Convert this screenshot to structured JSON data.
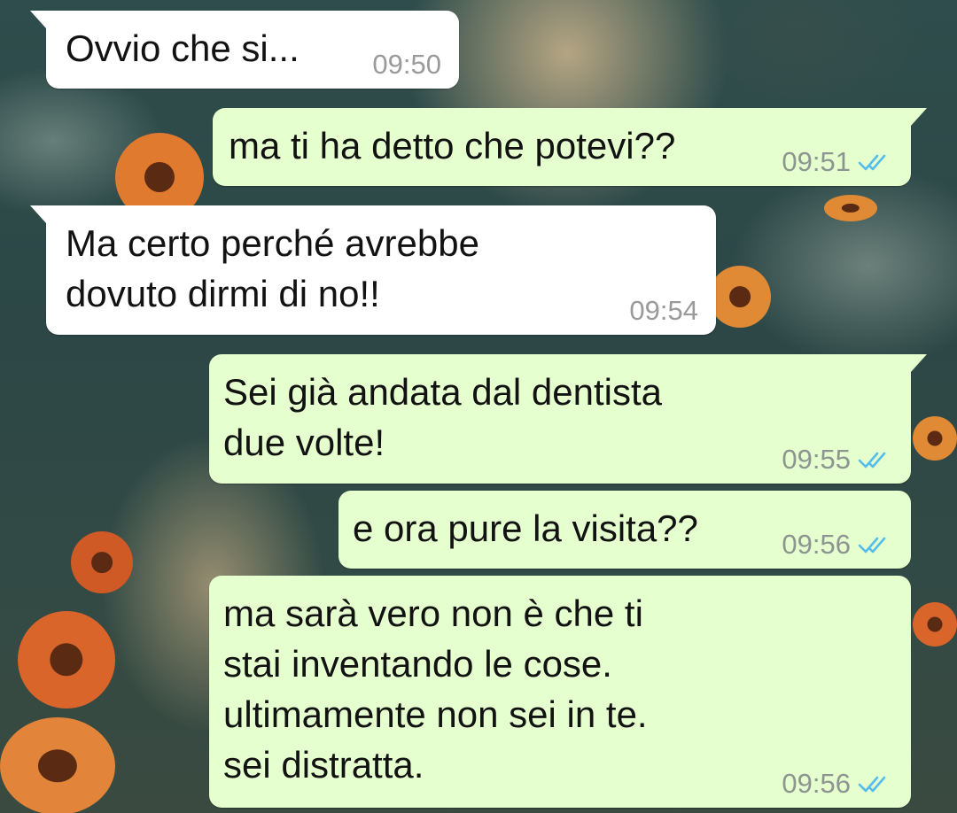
{
  "chat": {
    "messages": [
      {
        "direction": "incoming",
        "text": "Ovvio che si...",
        "time": "09:50"
      },
      {
        "direction": "outgoing",
        "text": "ma ti ha detto che potevi??",
        "time": "09:51",
        "status": "read"
      },
      {
        "direction": "incoming",
        "text": "Ma certo perché avrebbe\ndovuto dirmi di no!!",
        "time": "09:54"
      },
      {
        "direction": "outgoing",
        "text": "Sei già andata dal dentista\ndue volte!",
        "time": "09:55",
        "status": "read"
      },
      {
        "direction": "outgoing",
        "text": "e ora pure la visita??",
        "time": "09:56",
        "status": "read"
      },
      {
        "direction": "outgoing",
        "text": "ma sarà vero non è che ti\nstai inventando le cose.\nultimamente non sei in te.\nsei distratta.",
        "time": "09:56",
        "status": "read"
      }
    ]
  },
  "icons": {
    "read_receipt": "double-check-icon"
  },
  "colors": {
    "incoming_bubble": "#ffffff",
    "outgoing_bubble": "#e6ffcf",
    "read_tick": "#53bdeb",
    "timestamp": "#8d9590"
  }
}
